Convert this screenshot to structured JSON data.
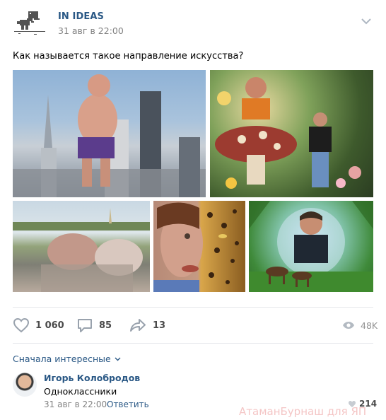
{
  "post": {
    "group_name": "IN IDEAS",
    "date": "31 авг в 22:00",
    "text": "Как называется такое направление искусства?",
    "photos": [
      {
        "alt": "photo-1"
      },
      {
        "alt": "photo-2"
      },
      {
        "alt": "photo-3"
      },
      {
        "alt": "photo-4"
      },
      {
        "alt": "photo-5"
      }
    ],
    "actions": {
      "likes": "1 060",
      "comments": "85",
      "shares": "13",
      "views": "48K"
    }
  },
  "comments": {
    "sort_label": "Сначала интересные",
    "items": [
      {
        "author": "Игорь Колобродов",
        "text": "Одноклассники",
        "date": "31 авг в 22:00",
        "reply_label": "Ответить",
        "likes": "214"
      }
    ]
  },
  "watermark": "АтаманБурнаш для ЯП",
  "colors": {
    "link": "#2a5885",
    "secondary": "#828282",
    "divider": "#e7e8ec"
  }
}
